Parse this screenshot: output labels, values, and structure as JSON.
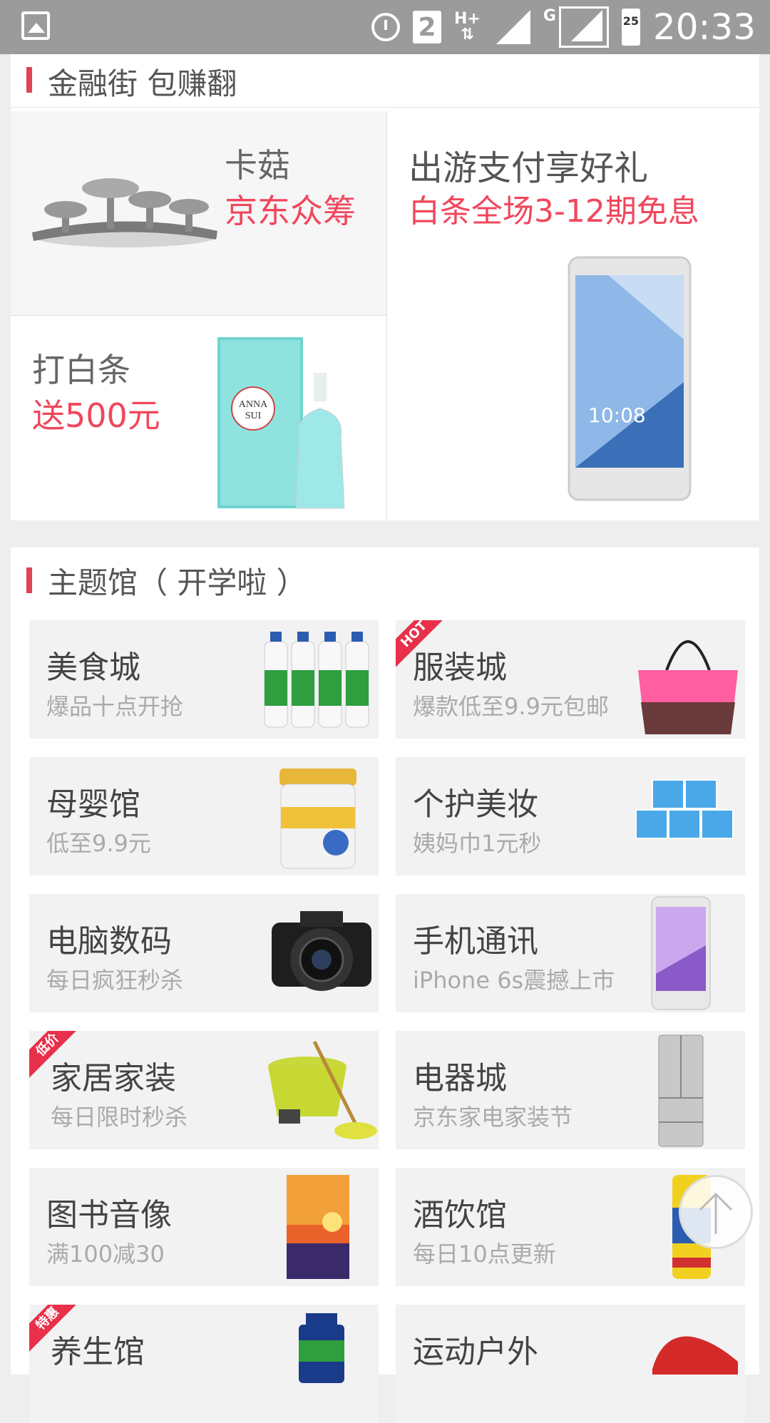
{
  "status_bar": {
    "sim_slot": "2",
    "network_hplus": "H+",
    "network_g": "G",
    "battery": "25",
    "time": "20:33"
  },
  "finance": {
    "title": "金融街 包赚翻",
    "cell1": {
      "title": "卡菇",
      "subtitle": "京东众筹"
    },
    "cell2": {
      "title": "打白条",
      "subtitle": "送500元"
    },
    "cell3": {
      "title": "出游支付享好礼",
      "subtitle": "白条全场3-12期免息",
      "phone_time": "10:08"
    }
  },
  "theme": {
    "title": "主题馆（ 开学啦 ）",
    "tiles": [
      {
        "name": "美食城",
        "sub": "爆品十点开抢",
        "badge": ""
      },
      {
        "name": "服装城",
        "sub": "爆款低至9.9元包邮",
        "badge": "HOT"
      },
      {
        "name": "母婴馆",
        "sub": "低至9.9元",
        "badge": ""
      },
      {
        "name": "个护美妆",
        "sub": "姨妈巾1元秒",
        "badge": ""
      },
      {
        "name": "电脑数码",
        "sub": "每日疯狂秒杀",
        "badge": ""
      },
      {
        "name": "手机通讯",
        "sub": "iPhone 6s震撼上市",
        "badge": ""
      },
      {
        "name": "家居家装",
        "sub": "每日限时秒杀",
        "badge": "低价"
      },
      {
        "name": "电器城",
        "sub": "京东家电家装节",
        "badge": ""
      },
      {
        "name": "图书音像",
        "sub": "满100减30",
        "badge": ""
      },
      {
        "name": "酒饮馆",
        "sub": "每日10点更新",
        "badge": ""
      },
      {
        "name": "养生馆",
        "sub": "",
        "badge": "特惠"
      },
      {
        "name": "运动户外",
        "sub": "",
        "badge": ""
      }
    ]
  },
  "colors": {
    "accent": "#e04356",
    "promo_red": "#f0475c"
  }
}
